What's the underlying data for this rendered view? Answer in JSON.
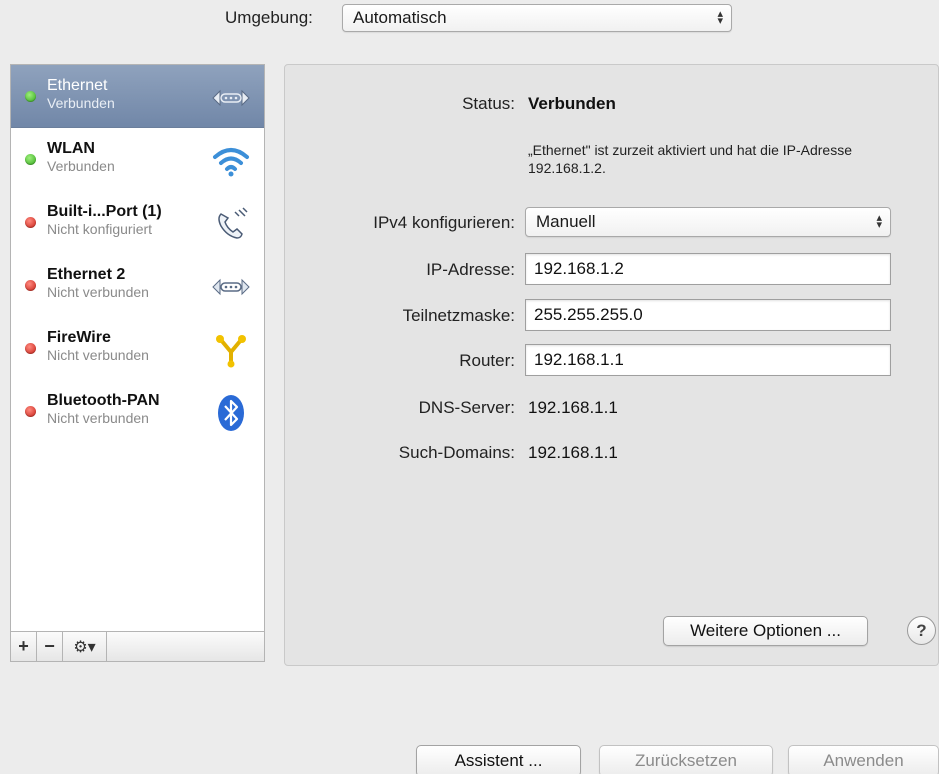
{
  "location": {
    "label": "Umgebung:",
    "value": "Automatisch"
  },
  "services": [
    {
      "name": "Ethernet",
      "status": "Verbunden",
      "dot": "green",
      "icon": "ethernet-icon",
      "selected": true
    },
    {
      "name": "WLAN",
      "status": "Verbunden",
      "dot": "green",
      "icon": "wifi-icon",
      "selected": false
    },
    {
      "name": "Built-i...Port (1)",
      "status": "Nicht konfiguriert",
      "dot": "red",
      "icon": "phone-icon",
      "selected": false
    },
    {
      "name": "Ethernet 2",
      "status": "Nicht verbunden",
      "dot": "red",
      "icon": "ethernet-icon",
      "selected": false
    },
    {
      "name": "FireWire",
      "status": "Nicht verbunden",
      "dot": "red",
      "icon": "firewire-icon",
      "selected": false
    },
    {
      "name": "Bluetooth-PAN",
      "status": "Nicht verbunden",
      "dot": "red",
      "icon": "bluetooth-icon",
      "selected": false
    }
  ],
  "sidebar_toolbar": {
    "add": "+",
    "remove": "−",
    "gear": "⚙▾"
  },
  "details": {
    "status_label": "Status:",
    "status_value": "Verbunden",
    "status_description": "„Ethernet\" ist zurzeit aktiviert und hat die IP-Adresse 192.168.1.2.",
    "ipv4_label": "IPv4 konfigurieren:",
    "ipv4_value": "Manuell",
    "ip_label": "IP-Adresse:",
    "ip_value": "192.168.1.2",
    "subnet_label": "Teilnetzmaske:",
    "subnet_value": "255.255.255.0",
    "router_label": "Router:",
    "router_value": "192.168.1.1",
    "dns_label": "DNS-Server:",
    "dns_value": "192.168.1.1",
    "search_label": "Such-Domains:",
    "search_value": "192.168.1.1",
    "more_options": "Weitere Optionen ...",
    "help": "?"
  },
  "footer": {
    "assistant": "Assistent ...",
    "revert": "Zurücksetzen",
    "apply": "Anwenden"
  },
  "colors": {
    "selected_row": "#7f94b3",
    "dot_green": "#2fa51a",
    "dot_red": "#c51d12"
  }
}
